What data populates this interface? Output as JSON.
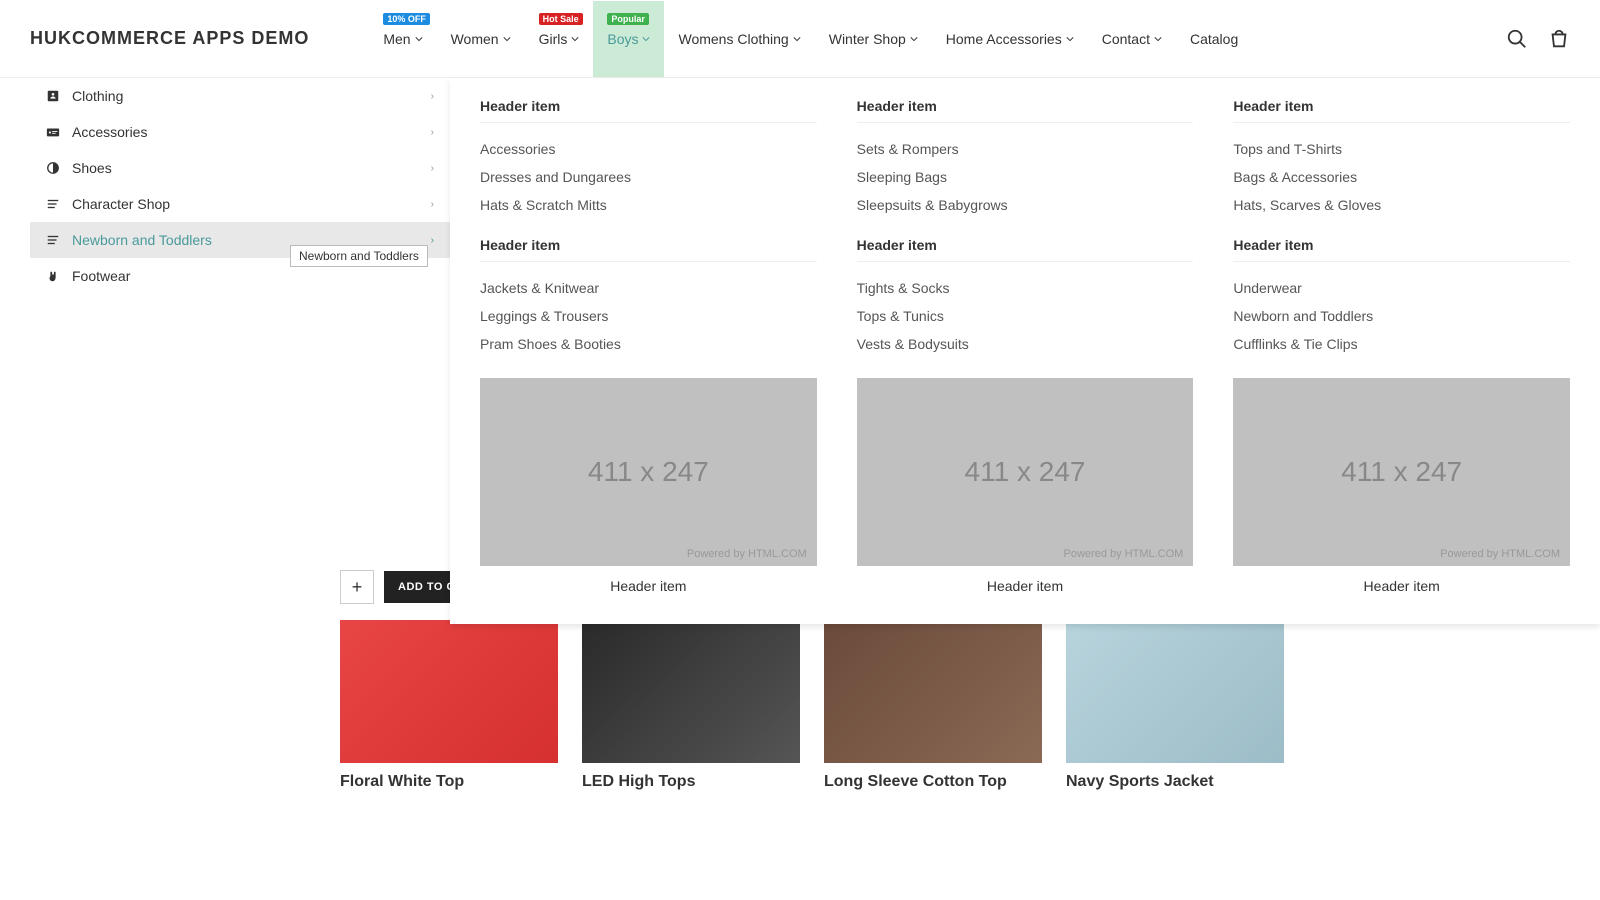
{
  "logo": "HUKCOMMERCE APPS DEMO",
  "nav": [
    {
      "label": "Men",
      "badge": "10% OFF",
      "badge_color": "blue",
      "dropdown": true
    },
    {
      "label": "Women",
      "dropdown": true
    },
    {
      "label": "Girls",
      "badge": "Hot Sale",
      "badge_color": "red",
      "dropdown": true
    },
    {
      "label": "Boys",
      "badge": "Popular",
      "badge_color": "green",
      "dropdown": true,
      "active": true
    },
    {
      "label": "Womens Clothing",
      "dropdown": true
    },
    {
      "label": "Winter Shop",
      "dropdown": true
    },
    {
      "label": "Home Accessories",
      "dropdown": true
    },
    {
      "label": "Contact",
      "dropdown": true
    },
    {
      "label": "Catalog",
      "dropdown": false
    }
  ],
  "sidebar": [
    {
      "icon": "contact-icon",
      "label": "Clothing"
    },
    {
      "icon": "card-icon",
      "label": "Accessories"
    },
    {
      "icon": "contrast-icon",
      "label": "Shoes"
    },
    {
      "icon": "lines-icon",
      "label": "Character Shop"
    },
    {
      "icon": "lines-icon",
      "label": "Newborn and Toddlers",
      "active": true
    },
    {
      "icon": "hand-icon",
      "label": "Footwear",
      "noarrow": true
    }
  ],
  "tooltip": "Newborn and Toddlers",
  "mega": {
    "cols": [
      {
        "groups": [
          {
            "header": "Header item",
            "links": [
              "Accessories",
              "Dresses and Dungarees",
              "Hats & Scratch Mitts"
            ]
          },
          {
            "header": "Header item",
            "links": [
              "Jackets & Knitwear",
              "Leggings & Trousers",
              "Pram Shoes & Booties"
            ]
          }
        ],
        "img_text": "411 x 247",
        "img_pb": "Powered by HTML.COM",
        "caption": "Header item"
      },
      {
        "groups": [
          {
            "header": "Header item",
            "links": [
              "Sets & Rompers",
              "Sleeping Bags",
              "Sleepsuits & Babygrows"
            ]
          },
          {
            "header": "Header item",
            "links": [
              "Tights & Socks",
              "Tops & Tunics",
              "Vests & Bodysuits"
            ]
          }
        ],
        "img_text": "411 x 247",
        "img_pb": "Powered by HTML.COM",
        "caption": "Header item"
      },
      {
        "groups": [
          {
            "header": "Header item",
            "links": [
              "Tops and T-Shirts",
              "Bags & Accessories",
              "Hats, Scarves & Gloves"
            ]
          },
          {
            "header": "Header item",
            "links": [
              "Underwear",
              "Newborn and Toddlers",
              "Cufflinks & Tie Clips"
            ]
          }
        ],
        "img_text": "411 x 247",
        "img_pb": "Powered by HTML.COM",
        "caption": "Header item"
      }
    ]
  },
  "add_btn": "ADD TO CART",
  "products": [
    {
      "title": "Floral White Top"
    },
    {
      "title": "LED High Tops"
    },
    {
      "title": "Long Sleeve Cotton Top"
    },
    {
      "title": "Navy Sports Jacket"
    }
  ]
}
